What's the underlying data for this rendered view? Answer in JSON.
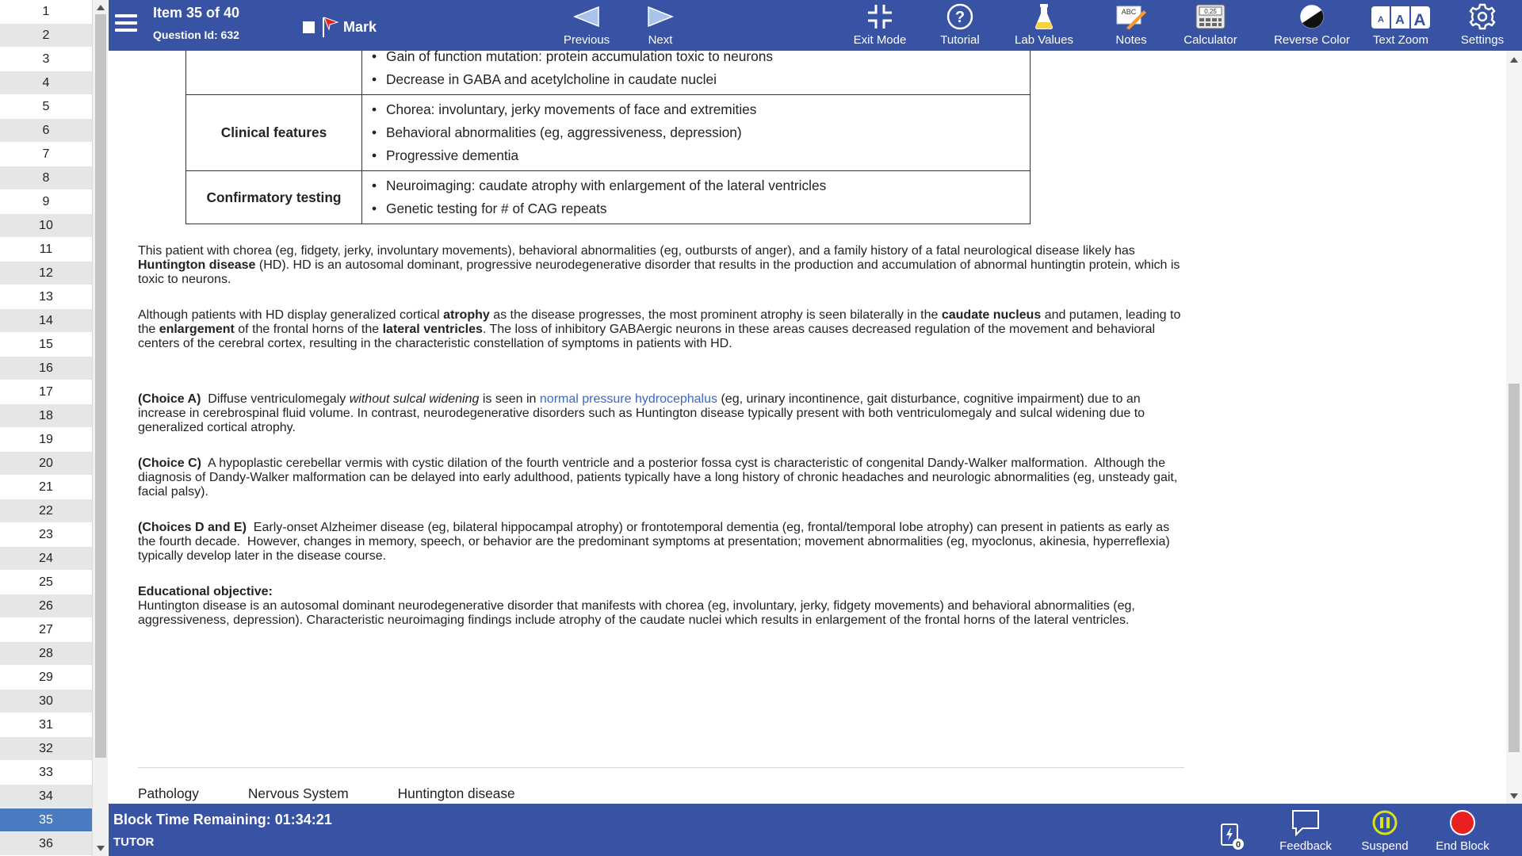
{
  "question_list": {
    "items": [
      "1",
      "2",
      "3",
      "4",
      "5",
      "6",
      "7",
      "8",
      "9",
      "10",
      "11",
      "12",
      "13",
      "14",
      "15",
      "16",
      "17",
      "18",
      "19",
      "20",
      "21",
      "22",
      "23",
      "24",
      "25",
      "26",
      "27",
      "28",
      "29",
      "30",
      "31",
      "32",
      "33",
      "34",
      "35",
      "36"
    ],
    "current": "35"
  },
  "header": {
    "item_title": "Item 35 of 40",
    "question_id": "Question Id: 632",
    "mark_label": "Mark",
    "previous_label": "Previous",
    "next_label": "Next",
    "exit_mode_label": "Exit Mode",
    "tutorial_label": "Tutorial",
    "lab_values_label": "Lab Values",
    "notes_label": "Notes",
    "calculator_label": "Calculator",
    "reverse_color_label": "Reverse Color",
    "text_zoom_label": "Text Zoom",
    "settings_label": "Settings",
    "notes_icon_text": "ABC",
    "calculator_icon_text": "0.25",
    "text_zoom_letters": [
      "A",
      "A",
      "A"
    ]
  },
  "table": {
    "top_row": [
      "Gain of function mutation: protein accumulation toxic to neurons",
      "Decrease in GABA and acetylcholine in caudate nuclei"
    ],
    "clinical_header": "Clinical features",
    "clinical": [
      "Chorea: involuntary, jerky movements of face and extremities",
      "Behavioral abnormalities (eg, aggressiveness, depression)",
      "Progressive dementia"
    ],
    "testing_header": "Confirmatory testing",
    "testing": [
      "Neuroimaging: caudate atrophy with enlargement of the lateral ventricles",
      "Genetic testing for # of CAG repeats"
    ]
  },
  "explanation": {
    "p1": {
      "a": "This patient with chorea (eg, fidgety, jerky, involuntary movements), behavioral abnormalities (eg, outbursts of anger), and a family history of a fatal neurological disease likely has ",
      "b": "Huntington disease",
      "c": " (HD).  HD is an autosomal dominant, progressive neurodegenerative disorder that results in the production and accumulation of abnormal huntingtin protein, which is toxic to neurons."
    },
    "p2": {
      "a": "Although patients with HD display generalized cortical ",
      "b": "atrophy",
      "c": " as the disease progresses, the most prominent atrophy is seen bilaterally in the ",
      "d": "caudate nucleus",
      "e": " and putamen, leading to the ",
      "f": "enlargement",
      "g": " of the frontal horns of the ",
      "h": "lateral ventricles",
      "i": ".  The loss of inhibitory GABAergic neurons in these areas causes decreased regulation of the movement and behavioral centers of the cerebral cortex, resulting in the characteristic constellation of symptoms in patients with HD."
    },
    "choiceA": {
      "label": "(Choice A)",
      "a": "  Diffuse ventriculomegaly ",
      "i": "without sulcal widening",
      "b": " is seen in ",
      "link": "normal pressure hydrocephalus",
      "c": " (eg, urinary incontinence, gait disturbance, cognitive impairment) due to an increase in cerebrospinal fluid volume.  In contrast, neurodegenerative disorders such as Huntington disease typically present with both ventriculomegaly and sulcal widening due to generalized cortical atrophy."
    },
    "choiceC": {
      "label": "(Choice C)",
      "text": "  A hypoplastic cerebellar vermis with cystic dilation of the fourth ventricle and a posterior fossa cyst is characteristic of congenital Dandy-Walker malformation.  Although the diagnosis of Dandy-Walker malformation can be delayed into early adulthood, patients typically have a long history of chronic headaches and neurologic abnormalities (eg, unsteady gait, facial palsy)."
    },
    "choiceDE": {
      "label": "(Choices D and E)",
      "text": "  Early-onset Alzheimer disease (eg, bilateral hippocampal atrophy) or frontotemporal dementia (eg, frontal/temporal lobe atrophy) can present in patients as early as the fourth decade.  However, changes in memory, speech, or behavior are the predominant symptoms at presentation; movement abnormalities (eg, myoclonus, akinesia, hyperreflexia) typically develop later in the disease course."
    },
    "edu_heading": "Educational objective:",
    "edu_text": "Huntington disease is an autosomal dominant neurodegenerative disorder that manifests with chorea (eg, involuntary, jerky, fidgety movements) and behavioral abnormalities (eg, aggressiveness, depression).  Characteristic neuroimaging findings include atrophy of the caudate nuclei which results in enlargement of the frontal horns of the lateral ventricles."
  },
  "tags": {
    "subject": "Pathology",
    "system": "Nervous System",
    "topic": "Huntington disease"
  },
  "footer": {
    "block_time": "Block Time Remaining: 01:34:21",
    "mode": "TUTOR",
    "flash_count": "0",
    "feedback_label": "Feedback",
    "suspend_label": "Suspend",
    "end_block_label": "End Block"
  },
  "colors": {
    "bar": "#3852a4",
    "current_item": "#4a7bc0",
    "link": "#3b67c6",
    "end_block": "#e8201f",
    "suspend": "#d8e21a"
  }
}
